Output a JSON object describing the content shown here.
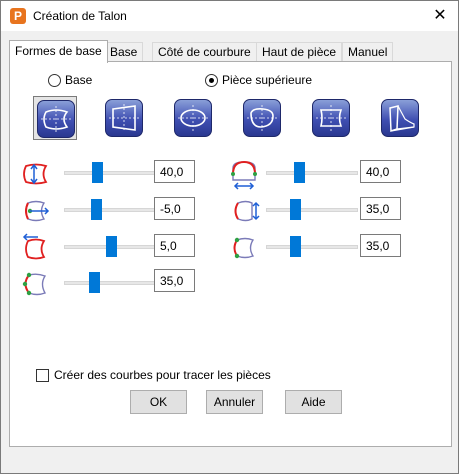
{
  "window": {
    "title": "Création de Talon",
    "app_icon_letter": "P",
    "close_symbol": "✕"
  },
  "tabs": [
    {
      "label": "Formes de base",
      "active": true
    },
    {
      "label": "Base",
      "active": false
    },
    {
      "label": "Côté de courbure",
      "active": false
    },
    {
      "label": "Haut de pièce",
      "active": false
    },
    {
      "label": "Manuel",
      "active": false
    }
  ],
  "mode": {
    "base_label": "Base",
    "upper_label": "Pièce supérieure",
    "selected": "upper"
  },
  "shape_buttons": [
    {
      "icon": "heel-shape-1-icon",
      "selected": true
    },
    {
      "icon": "heel-shape-2-icon",
      "selected": false
    },
    {
      "icon": "heel-shape-3-icon",
      "selected": false
    },
    {
      "icon": "heel-shape-4-icon",
      "selected": false
    },
    {
      "icon": "heel-shape-5-icon",
      "selected": false
    },
    {
      "icon": "heel-3d-icon",
      "selected": false
    }
  ],
  "params_left": [
    {
      "icon": "heel-height-icon",
      "value": "40,0",
      "slider_fraction": 0.34
    },
    {
      "icon": "heel-offset-icon",
      "value": "-5,0",
      "slider_fraction": 0.33
    },
    {
      "icon": "heel-shift-icon",
      "value": "5,0",
      "slider_fraction": 0.52
    },
    {
      "icon": "heel-curve-icon",
      "value": "35,0",
      "slider_fraction": 0.31
    }
  ],
  "params_right": [
    {
      "icon": "heel-width-icon",
      "value": "40,0",
      "slider_fraction": 0.34
    },
    {
      "icon": "heel-side-icon",
      "value": "35,0",
      "slider_fraction": 0.3
    },
    {
      "icon": "heel-corner-icon",
      "value": "35,0",
      "slider_fraction": 0.3
    }
  ],
  "options": {
    "create_curves_label": "Créer des courbes pour tracer les pièces",
    "create_curves_checked": false
  },
  "buttons": {
    "ok": "OK",
    "cancel": "Annuler",
    "help": "Aide"
  },
  "colors": {
    "accent": "#0078d7",
    "shape_button": "#3f4fb2",
    "curve_red": "#e02020",
    "point_green": "#2ea043",
    "arrow_blue": "#1e5fd6"
  }
}
